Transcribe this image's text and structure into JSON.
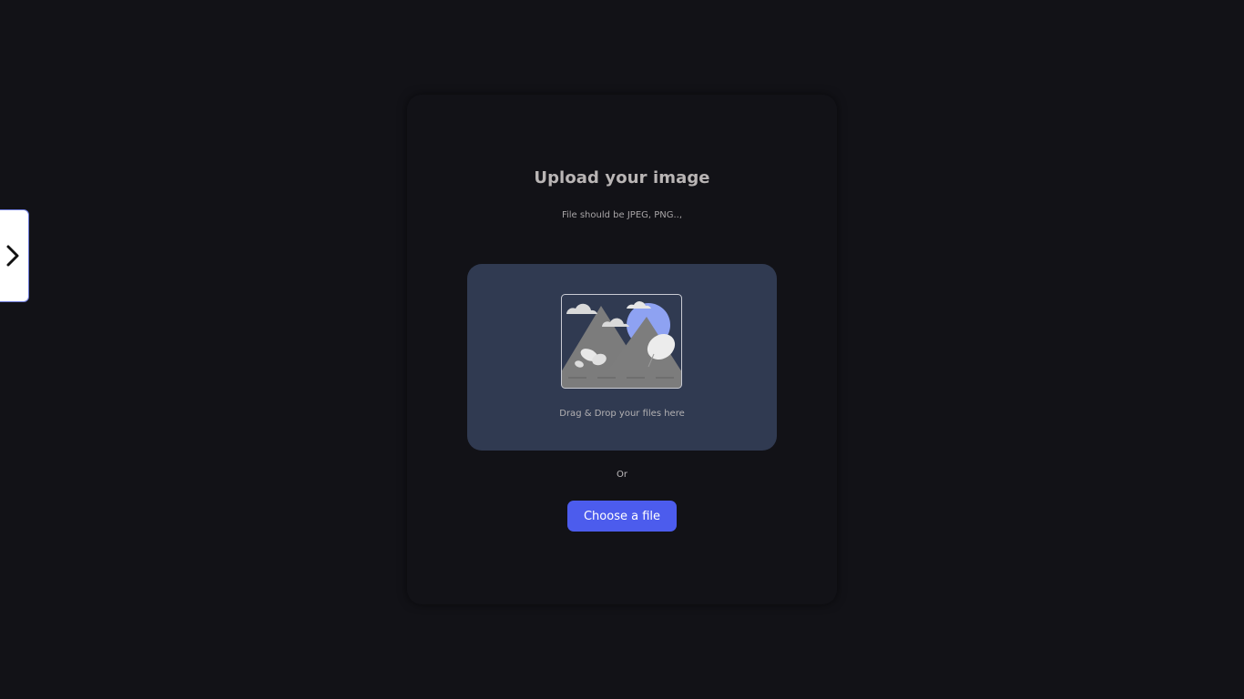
{
  "sidebar_toggle": {
    "icon": "chevron-right-icon"
  },
  "upload": {
    "title": "Upload your image",
    "subtitle": "File should be JPEG, PNG..,",
    "dropzone_label": "Drag & Drop your files here",
    "illustration_icon": "image-placeholder-icon",
    "or_label": "Or",
    "choose_button_label": "Choose a file"
  },
  "colors": {
    "background": "#121217",
    "dropzone": "#303a51",
    "accent": "#4c5ced",
    "title_text": "#b9b5b5"
  }
}
